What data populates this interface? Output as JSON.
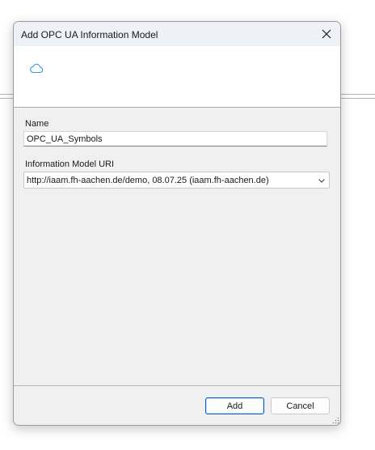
{
  "dialog": {
    "title": "Add OPC UA Information Model",
    "close_icon": "close-icon",
    "header_icon": "cloud-icon"
  },
  "form": {
    "name_label": "Name",
    "name_value": "OPC_UA_Symbols",
    "uri_label": "Information Model URI",
    "uri_value": "http://iaam.fh-aachen.de/demo, 08.07.25 (iaam.fh-aachen.de)",
    "uri_dropdown_icon": "chevron-down-icon"
  },
  "buttons": {
    "add_label": "Add",
    "cancel_label": "Cancel"
  },
  "colors": {
    "accent": "#005fb8",
    "icon_accent": "#2b9fd6"
  }
}
